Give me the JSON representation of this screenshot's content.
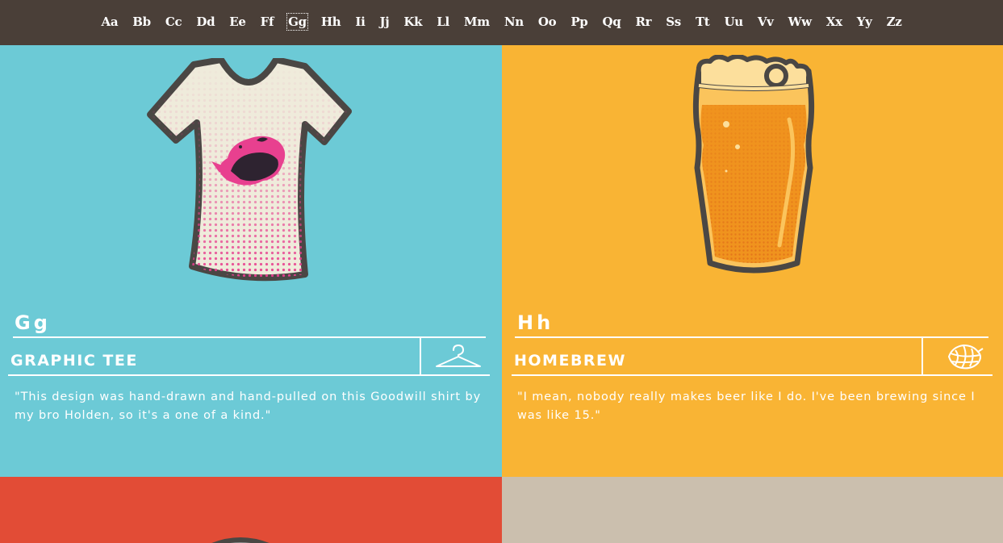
{
  "nav": {
    "letters": [
      "Aa",
      "Bb",
      "Cc",
      "Dd",
      "Ee",
      "Ff",
      "Gg",
      "Hh",
      "Ii",
      "Jj",
      "Kk",
      "Ll",
      "Mm",
      "Nn",
      "Oo",
      "Pp",
      "Qq",
      "Rr",
      "Ss",
      "Tt",
      "Uu",
      "Vv",
      "Ww",
      "Xx",
      "Yy",
      "Zz"
    ],
    "active": "Gg"
  },
  "panels": {
    "g": {
      "letter": "Gg",
      "title": "GRAPHIC TEE",
      "icon": "hanger-icon",
      "description": "\"This design was hand-drawn and hand-pulled on this Goodwill shirt by my bro Holden, so it's a one of a kind.\"",
      "color": "#6ccad6"
    },
    "h": {
      "letter": "Hh",
      "title": "HOMEBREW",
      "icon": "hops-icon",
      "description": "\"I mean, nobody really makes beer like I do. I've been brewing since I was like 15.\"",
      "color": "#f9b434"
    },
    "i": {
      "color": "#e24c36"
    },
    "j": {
      "color": "#cbbfae"
    }
  },
  "colors": {
    "nav_bg": "#4a3f38",
    "outline": "#4a4744",
    "shirt": "#efebdb",
    "pink": "#e8408f",
    "beer": "#f0931e",
    "foam": "#fcdf9c"
  }
}
